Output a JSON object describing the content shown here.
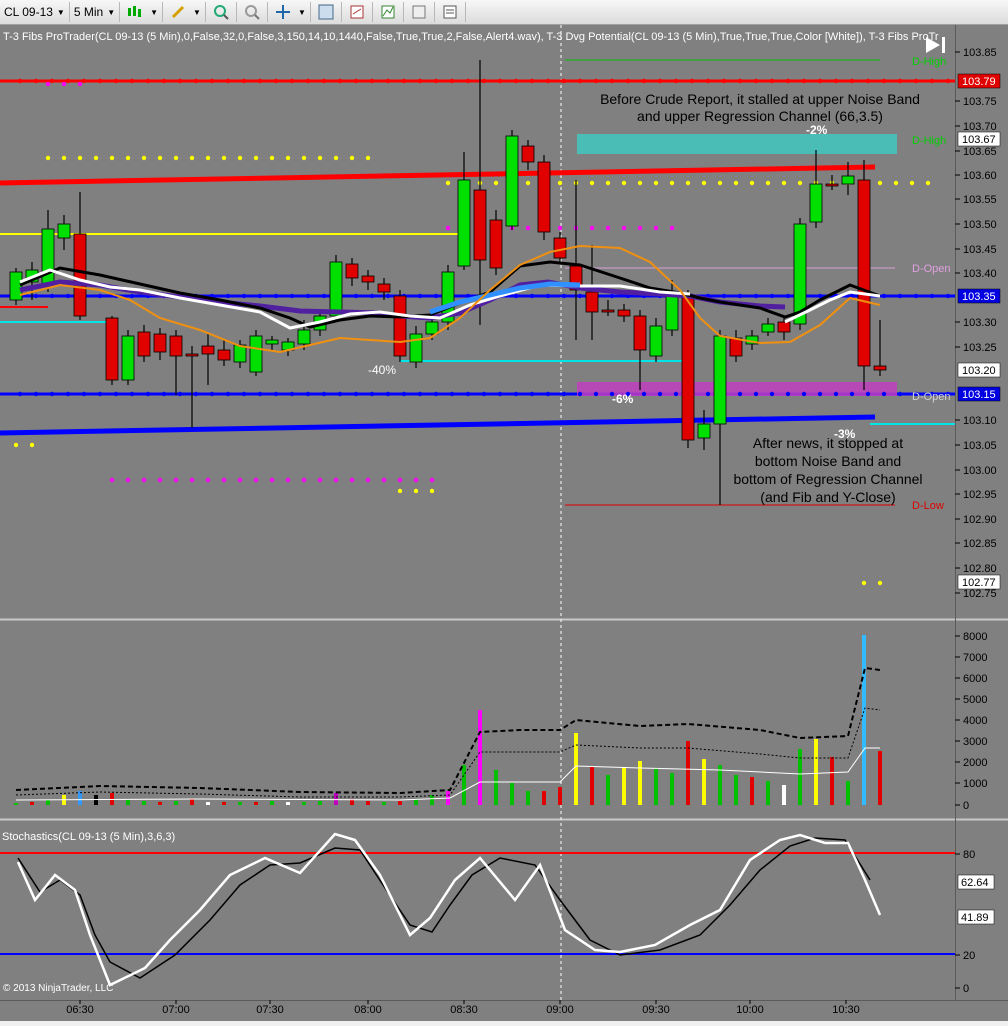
{
  "toolbar": {
    "instrument": "CL 09-13",
    "interval": "5 Min",
    "icons": [
      "bar-style-icon",
      "pencil-draw-icon",
      "zoom-in-icon",
      "zoom-out-icon",
      "crosshair-icon",
      "magnifier-icon",
      "strategy-icon",
      "indicators-icon",
      "data-box-icon",
      "properties-icon"
    ]
  },
  "header": {
    "indicator_line": "T-3 Fibs ProTrader(CL 09-13 (5 Min),0,False,32,0,False,3,150,14,10,1440,False,True,True,2,False,Alert4.wav),  T-3 Dvg Potential(CL 09-13 (5 Min),True,True,True,Color [White]),  T-3 Fibs ProTr"
  },
  "price_panel": {
    "axis_ticks": [
      "103.85",
      "103.75",
      "103.70",
      "103.65",
      "103.60",
      "103.55",
      "103.50",
      "103.45",
      "103.40",
      "103.30",
      "103.25",
      "103.10",
      "103.05",
      "103.00",
      "102.95",
      "102.90",
      "102.85",
      "102.80",
      "102.75"
    ],
    "badges": [
      {
        "label": "103.79",
        "color": "#e00000",
        "text": "#ffffff"
      },
      {
        "label": "103.67",
        "color": "#ffffff",
        "text": "#000000"
      },
      {
        "label": "103.35",
        "color": "#0000e0",
        "text": "#ffffff"
      },
      {
        "label": "103.20",
        "color": "#ffffff",
        "text": "#000000"
      },
      {
        "label": "103.15",
        "color": "#0000e0",
        "text": "#ffffff"
      },
      {
        "label": "102.77",
        "color": "#ffffff",
        "text": "#000000"
      }
    ],
    "level_labels": {
      "d_high_top": "D-High",
      "d_high_mid": "D-High",
      "d_open_top": "D-Open",
      "d_open_bottom": "D-Open",
      "d_low": "D-Low"
    },
    "fib_labels": {
      "minus40": "-40%",
      "minus6": "-6%",
      "minus2": "-2%",
      "minus3": "-3%"
    },
    "annotation_before": [
      "Before Crude Report, it stalled at upper Noise Band",
      "and upper Regression Channel (66,3.5)"
    ],
    "annotation_after": [
      "After news, it stopped at",
      "bottom Noise Band and",
      "bottom of Regression Channel",
      "(and Fib and Y-Close)"
    ]
  },
  "volume_panel": {
    "axis_ticks": [
      "8000",
      "7000",
      "6000",
      "5000",
      "4000",
      "3000",
      "2000",
      "1000",
      "0"
    ]
  },
  "stoch_panel": {
    "title": "Stochastics(CL 09-13 (5 Min),3,6,3)",
    "axis_ticks": [
      "80",
      "20",
      "0"
    ],
    "badges": [
      {
        "label": "62.64"
      },
      {
        "label": "41.89"
      }
    ]
  },
  "time_axis": {
    "labels": [
      "06:30",
      "07:00",
      "07:30",
      "08:00",
      "08:30",
      "09:00",
      "09:30",
      "10:00",
      "10:30"
    ]
  },
  "copyright": "© 2013 NinjaTrader, LLC",
  "colors": {
    "bg": "#808080",
    "up": "#00e000",
    "down": "#e00000",
    "noise_upper": "#e00000",
    "noise_lower": "#0000e0"
  }
}
